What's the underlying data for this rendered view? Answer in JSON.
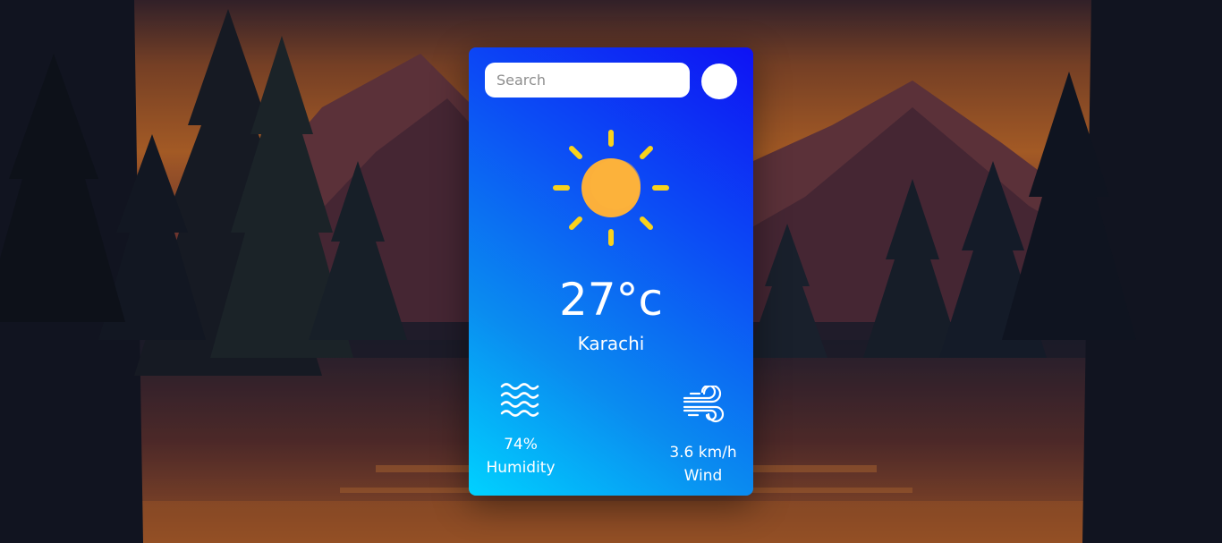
{
  "search": {
    "placeholder": "Search",
    "value": "",
    "button_icon": "search-icon"
  },
  "weather": {
    "icon": "sun-icon",
    "temperature": "27°c",
    "city": "Karachi",
    "humidity": {
      "icon": "waves-icon",
      "value": "74%",
      "label": "Humidity"
    },
    "wind": {
      "icon": "wind-icon",
      "value": "3.6 km/h",
      "label": "Wind"
    }
  },
  "colors": {
    "card_gradient_start": "#00d2ff",
    "card_gradient_end": "#0e12f4",
    "sun_core": "#fbb03b",
    "sun_rays": "#f9d21b"
  }
}
